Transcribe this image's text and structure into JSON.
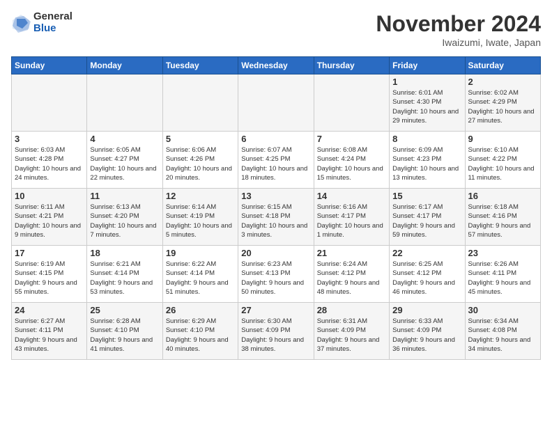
{
  "logo": {
    "general": "General",
    "blue": "Blue"
  },
  "title": "November 2024",
  "subtitle": "Iwaizumi, Iwate, Japan",
  "days_header": [
    "Sunday",
    "Monday",
    "Tuesday",
    "Wednesday",
    "Thursday",
    "Friday",
    "Saturday"
  ],
  "weeks": [
    [
      {
        "num": "",
        "info": ""
      },
      {
        "num": "",
        "info": ""
      },
      {
        "num": "",
        "info": ""
      },
      {
        "num": "",
        "info": ""
      },
      {
        "num": "",
        "info": ""
      },
      {
        "num": "1",
        "info": "Sunrise: 6:01 AM\nSunset: 4:30 PM\nDaylight: 10 hours and 29 minutes."
      },
      {
        "num": "2",
        "info": "Sunrise: 6:02 AM\nSunset: 4:29 PM\nDaylight: 10 hours and 27 minutes."
      }
    ],
    [
      {
        "num": "3",
        "info": "Sunrise: 6:03 AM\nSunset: 4:28 PM\nDaylight: 10 hours and 24 minutes."
      },
      {
        "num": "4",
        "info": "Sunrise: 6:05 AM\nSunset: 4:27 PM\nDaylight: 10 hours and 22 minutes."
      },
      {
        "num": "5",
        "info": "Sunrise: 6:06 AM\nSunset: 4:26 PM\nDaylight: 10 hours and 20 minutes."
      },
      {
        "num": "6",
        "info": "Sunrise: 6:07 AM\nSunset: 4:25 PM\nDaylight: 10 hours and 18 minutes."
      },
      {
        "num": "7",
        "info": "Sunrise: 6:08 AM\nSunset: 4:24 PM\nDaylight: 10 hours and 15 minutes."
      },
      {
        "num": "8",
        "info": "Sunrise: 6:09 AM\nSunset: 4:23 PM\nDaylight: 10 hours and 13 minutes."
      },
      {
        "num": "9",
        "info": "Sunrise: 6:10 AM\nSunset: 4:22 PM\nDaylight: 10 hours and 11 minutes."
      }
    ],
    [
      {
        "num": "10",
        "info": "Sunrise: 6:11 AM\nSunset: 4:21 PM\nDaylight: 10 hours and 9 minutes."
      },
      {
        "num": "11",
        "info": "Sunrise: 6:13 AM\nSunset: 4:20 PM\nDaylight: 10 hours and 7 minutes."
      },
      {
        "num": "12",
        "info": "Sunrise: 6:14 AM\nSunset: 4:19 PM\nDaylight: 10 hours and 5 minutes."
      },
      {
        "num": "13",
        "info": "Sunrise: 6:15 AM\nSunset: 4:18 PM\nDaylight: 10 hours and 3 minutes."
      },
      {
        "num": "14",
        "info": "Sunrise: 6:16 AM\nSunset: 4:17 PM\nDaylight: 10 hours and 1 minute."
      },
      {
        "num": "15",
        "info": "Sunrise: 6:17 AM\nSunset: 4:17 PM\nDaylight: 9 hours and 59 minutes."
      },
      {
        "num": "16",
        "info": "Sunrise: 6:18 AM\nSunset: 4:16 PM\nDaylight: 9 hours and 57 minutes."
      }
    ],
    [
      {
        "num": "17",
        "info": "Sunrise: 6:19 AM\nSunset: 4:15 PM\nDaylight: 9 hours and 55 minutes."
      },
      {
        "num": "18",
        "info": "Sunrise: 6:21 AM\nSunset: 4:14 PM\nDaylight: 9 hours and 53 minutes."
      },
      {
        "num": "19",
        "info": "Sunrise: 6:22 AM\nSunset: 4:14 PM\nDaylight: 9 hours and 51 minutes."
      },
      {
        "num": "20",
        "info": "Sunrise: 6:23 AM\nSunset: 4:13 PM\nDaylight: 9 hours and 50 minutes."
      },
      {
        "num": "21",
        "info": "Sunrise: 6:24 AM\nSunset: 4:12 PM\nDaylight: 9 hours and 48 minutes."
      },
      {
        "num": "22",
        "info": "Sunrise: 6:25 AM\nSunset: 4:12 PM\nDaylight: 9 hours and 46 minutes."
      },
      {
        "num": "23",
        "info": "Sunrise: 6:26 AM\nSunset: 4:11 PM\nDaylight: 9 hours and 45 minutes."
      }
    ],
    [
      {
        "num": "24",
        "info": "Sunrise: 6:27 AM\nSunset: 4:11 PM\nDaylight: 9 hours and 43 minutes."
      },
      {
        "num": "25",
        "info": "Sunrise: 6:28 AM\nSunset: 4:10 PM\nDaylight: 9 hours and 41 minutes."
      },
      {
        "num": "26",
        "info": "Sunrise: 6:29 AM\nSunset: 4:10 PM\nDaylight: 9 hours and 40 minutes."
      },
      {
        "num": "27",
        "info": "Sunrise: 6:30 AM\nSunset: 4:09 PM\nDaylight: 9 hours and 38 minutes."
      },
      {
        "num": "28",
        "info": "Sunrise: 6:31 AM\nSunset: 4:09 PM\nDaylight: 9 hours and 37 minutes."
      },
      {
        "num": "29",
        "info": "Sunrise: 6:33 AM\nSunset: 4:09 PM\nDaylight: 9 hours and 36 minutes."
      },
      {
        "num": "30",
        "info": "Sunrise: 6:34 AM\nSunset: 4:08 PM\nDaylight: 9 hours and 34 minutes."
      }
    ]
  ]
}
